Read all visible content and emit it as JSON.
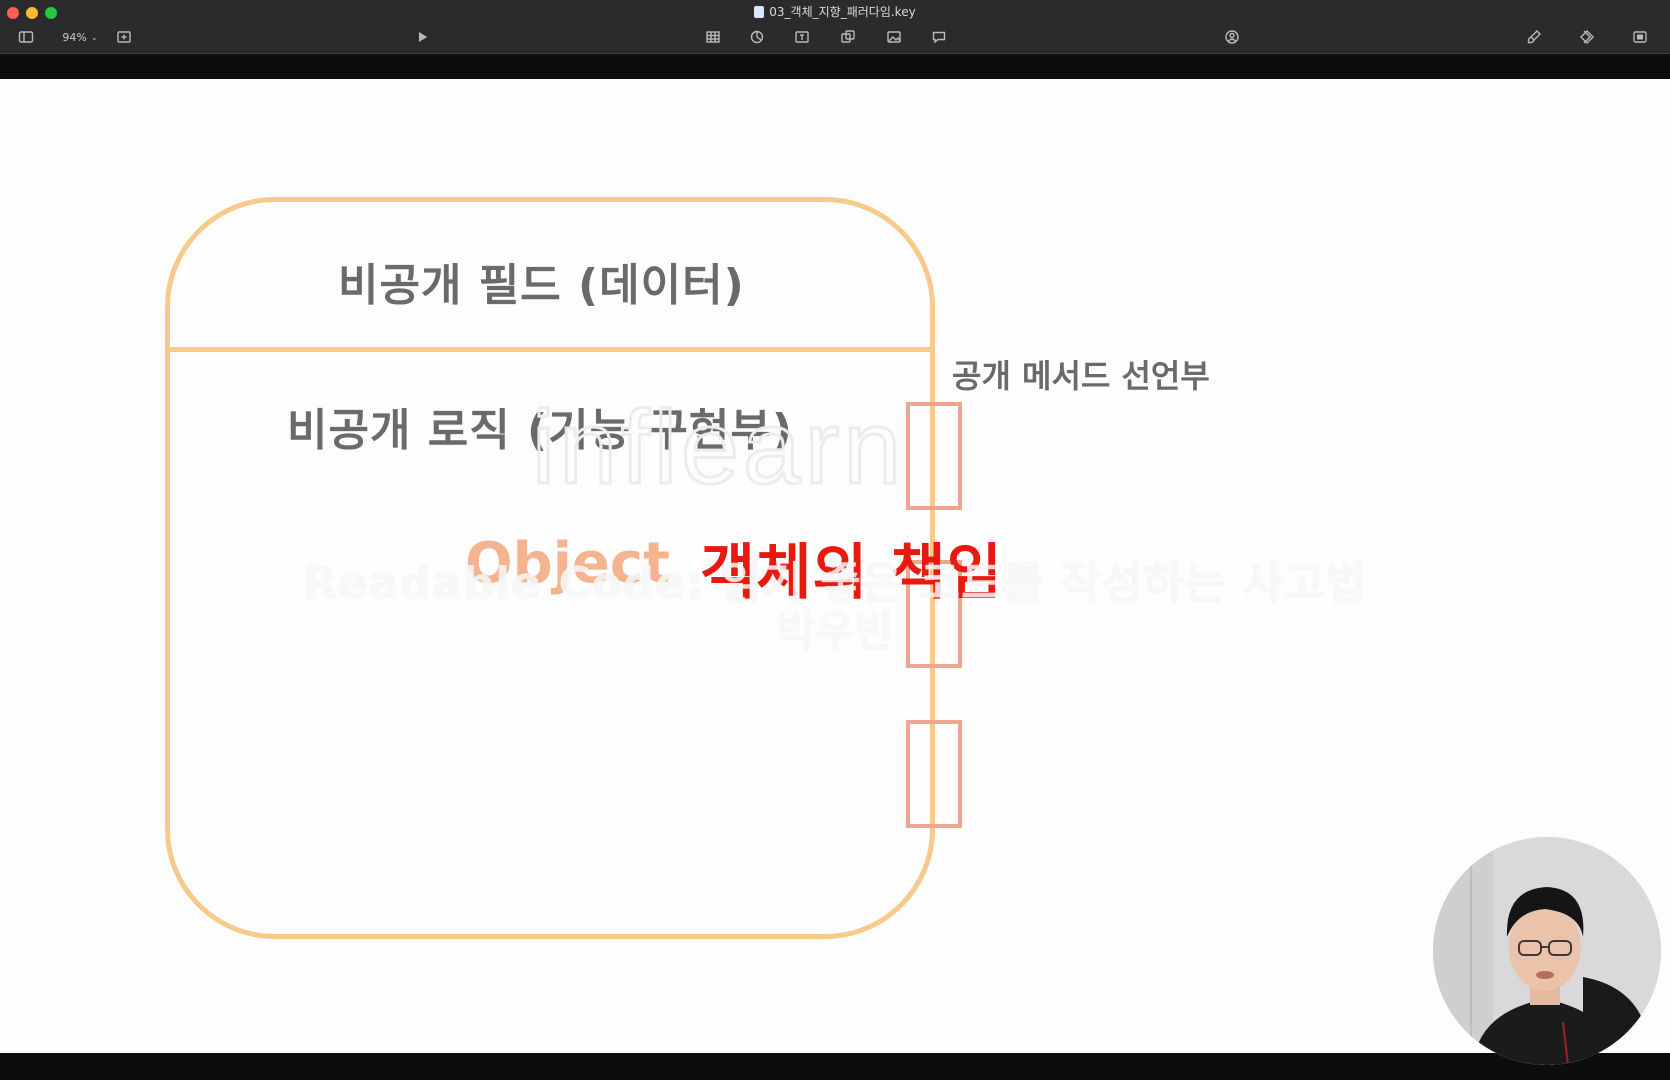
{
  "window": {
    "title": "03_객체_지향_패러다임.key"
  },
  "toolbar": {
    "zoom_label": "94%",
    "items": [
      "sidebar-toggle",
      "zoom",
      "add-slide",
      "play",
      "table",
      "chart",
      "text",
      "shape",
      "media",
      "comment",
      "collaborate",
      "format",
      "animate",
      "document"
    ]
  },
  "slide": {
    "private_field_label": "비공개 필드 (데이터)",
    "private_logic_label": "비공개 로직 (기능 구현부)",
    "public_method_label": "공개 메서드 선언부",
    "object_word": "Object",
    "responsibility_label": "객체의 책임",
    "watermark_text": "inflearn",
    "colors": {
      "box_outline": "#f7c98a",
      "slot_outline": "#f0a590",
      "object_word": "#f4b48f",
      "responsibility": "#e81a0f",
      "hand_text": "#6a6a6a"
    }
  },
  "caption": {
    "line1": "Readable Code: 읽기 좋은 코드를 작성하는 사고법",
    "line2": "박우빈"
  }
}
